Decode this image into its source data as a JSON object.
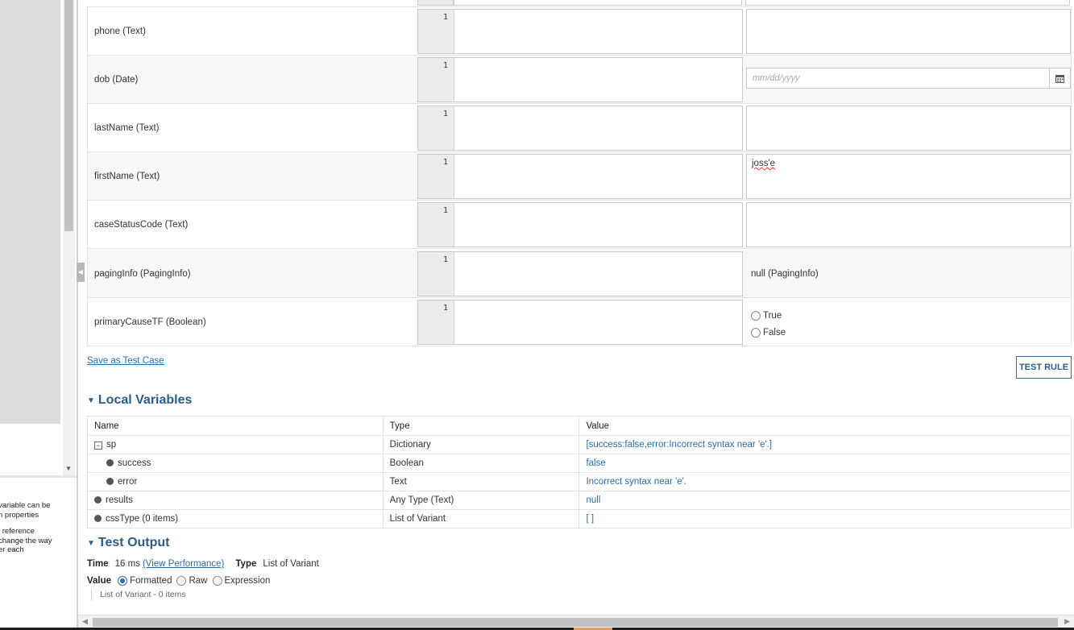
{
  "help_text": {
    "para1_line1": "variable can be",
    "para1_line2": "n properties",
    "para2_line1": "l reference",
    "para2_line2": "change the way",
    "para2_line3": "er each"
  },
  "line_number": "1",
  "params": [
    {
      "name": "phone (Text)",
      "value": ""
    },
    {
      "name": "dob (Date)",
      "placeholder": "mm/dd/yyyy"
    },
    {
      "name": "lastName (Text)",
      "value": ""
    },
    {
      "name": "firstName (Text)",
      "value": "joss'e"
    },
    {
      "name": "caseStatusCode (Text)",
      "value": ""
    },
    {
      "name": "pagingInfo (PagingInfo)",
      "value": "null (PagingInfo)"
    },
    {
      "name": "primaryCauseTF (Boolean)",
      "options": [
        "True",
        "False"
      ]
    }
  ],
  "actions": {
    "save_test_case": "Save as Test Case",
    "test_rule": "TEST RULE"
  },
  "local_variables": {
    "title": "Local Variables",
    "headers": {
      "name": "Name",
      "type": "Type",
      "value": "Value"
    },
    "rows": [
      {
        "name": "sp",
        "type": "Dictionary",
        "value": "[success:false,error:Incorrect syntax near 'e'.]"
      },
      {
        "name": "success",
        "type": "Boolean",
        "value": "false"
      },
      {
        "name": "error",
        "type": "Text",
        "value": "Incorrect syntax near 'e'."
      },
      {
        "name": "results",
        "type": "Any Type (Text)",
        "value": "null"
      },
      {
        "name": "cssType (0 items)",
        "type": "List of Variant",
        "value": "[ ]"
      }
    ]
  },
  "test_output": {
    "title": "Test Output",
    "time_label": "Time",
    "time_value": "16 ms",
    "view_performance": "(View Performance)",
    "type_label": "Type",
    "type_value": "List of Variant",
    "value_label": "Value",
    "formats": [
      "Formatted",
      "Raw",
      "Expression"
    ],
    "selected_format": "Formatted",
    "result": "List of Variant - 0 items"
  },
  "colors": {
    "accent": "#2d6ca2",
    "heading": "#2d5c86"
  }
}
